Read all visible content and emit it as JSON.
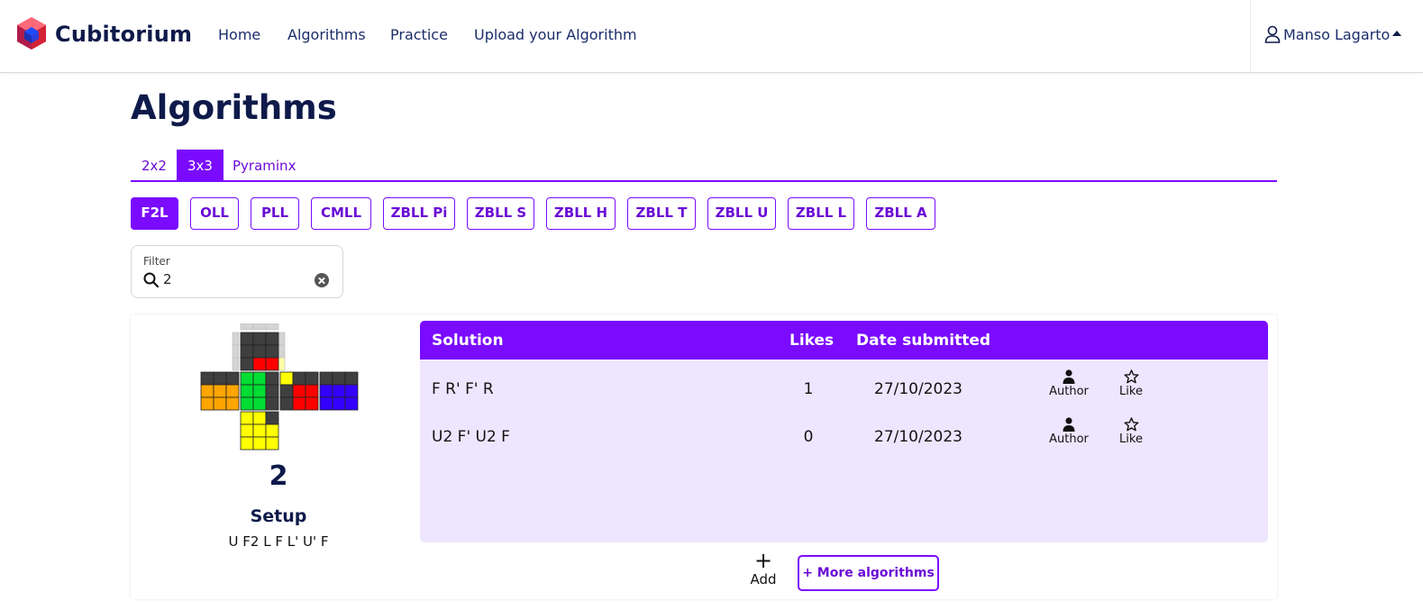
{
  "brand": {
    "name": "Cubitorium"
  },
  "nav": {
    "items": [
      "Home",
      "Algorithms",
      "Practice",
      "Upload your Algorithm"
    ]
  },
  "user": {
    "name": "Manso Lagarto"
  },
  "page": {
    "title": "Algorithms"
  },
  "puzzle_tabs": {
    "items": [
      "2x2",
      "3x3",
      "Pyraminx"
    ],
    "active": "3x3"
  },
  "categories": {
    "items": [
      "F2L",
      "OLL",
      "PLL",
      "CMLL",
      "ZBLL Pi",
      "ZBLL S",
      "ZBLL H",
      "ZBLL T",
      "ZBLL U",
      "ZBLL L",
      "ZBLL A"
    ],
    "active": "F2L"
  },
  "filter": {
    "label": "Filter",
    "value": "2"
  },
  "case": {
    "number": "2",
    "setup_label": "Setup",
    "setup_moves": "U F2 L F L' U' F",
    "cube_colors": {
      "dark": "#3f3f3f",
      "light_gray": "#d4d4d4",
      "red": "#ff0000",
      "green": "#00dd33",
      "orange": "#ffa500",
      "blue": "#3300ff",
      "yellow": "#ffff00",
      "pale_yellow": "#ffffaa"
    }
  },
  "table": {
    "headers": {
      "solution": "Solution",
      "likes": "Likes",
      "date": "Date submitted"
    },
    "rows": [
      {
        "solution": "F R' F' R",
        "likes": "1",
        "date": "27/10/2023",
        "author": "Author",
        "like": "Like"
      },
      {
        "solution": "U2 F' U2 F",
        "likes": "0",
        "date": "27/10/2023",
        "author": "Author",
        "like": "Like"
      }
    ]
  },
  "actions": {
    "add": "Add",
    "more": "+ More algorithms"
  },
  "colors": {
    "accent": "#7a0bff",
    "accent_text": "#6a0bd6",
    "panel": "#eee6ff",
    "navy": "#0e1a4a"
  }
}
